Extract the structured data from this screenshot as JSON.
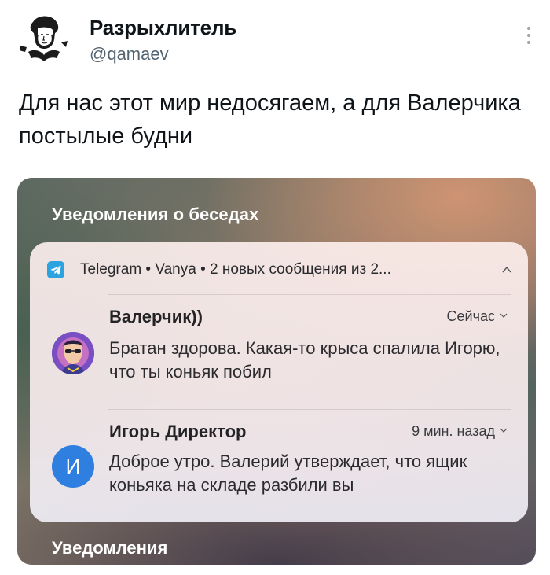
{
  "tweet": {
    "author_name": "Разрыхлитель",
    "author_handle": "@qamaev",
    "text": "Для нас этот мир недосягаем, а для Валерчика постылые будни",
    "avatar_icon": "pushkin-portrait-avatar",
    "more_icon": "more-vertical-icon"
  },
  "screenshot": {
    "section_title": "Уведомления о беседах",
    "section_title_bottom": "Уведомления",
    "app_header": "Telegram • Vanya • 2 новых сообщения из 2...",
    "app_icon": "telegram-icon",
    "collapse_icon": "chevron-up-icon",
    "messages": [
      {
        "sender": "Валерчик))",
        "time": "Сейчас",
        "text": "Братан здорова. Какая-то крыса спалила Игорю, что ты коньяк побил",
        "avatar": "photo",
        "avatar_icon": "cyberpunk-avatar-icon"
      },
      {
        "sender": "Игорь Директор",
        "time": "9 мин. назад",
        "text": "Доброе утро. Валерий утверждает, что ящик коньяка на складе разбили вы",
        "avatar": "letter",
        "avatar_letter": "И"
      }
    ]
  },
  "colors": {
    "telegram_blue": "#2aa3de",
    "avatar_blue": "#2f7fe0",
    "handle_gray": "#536471"
  }
}
